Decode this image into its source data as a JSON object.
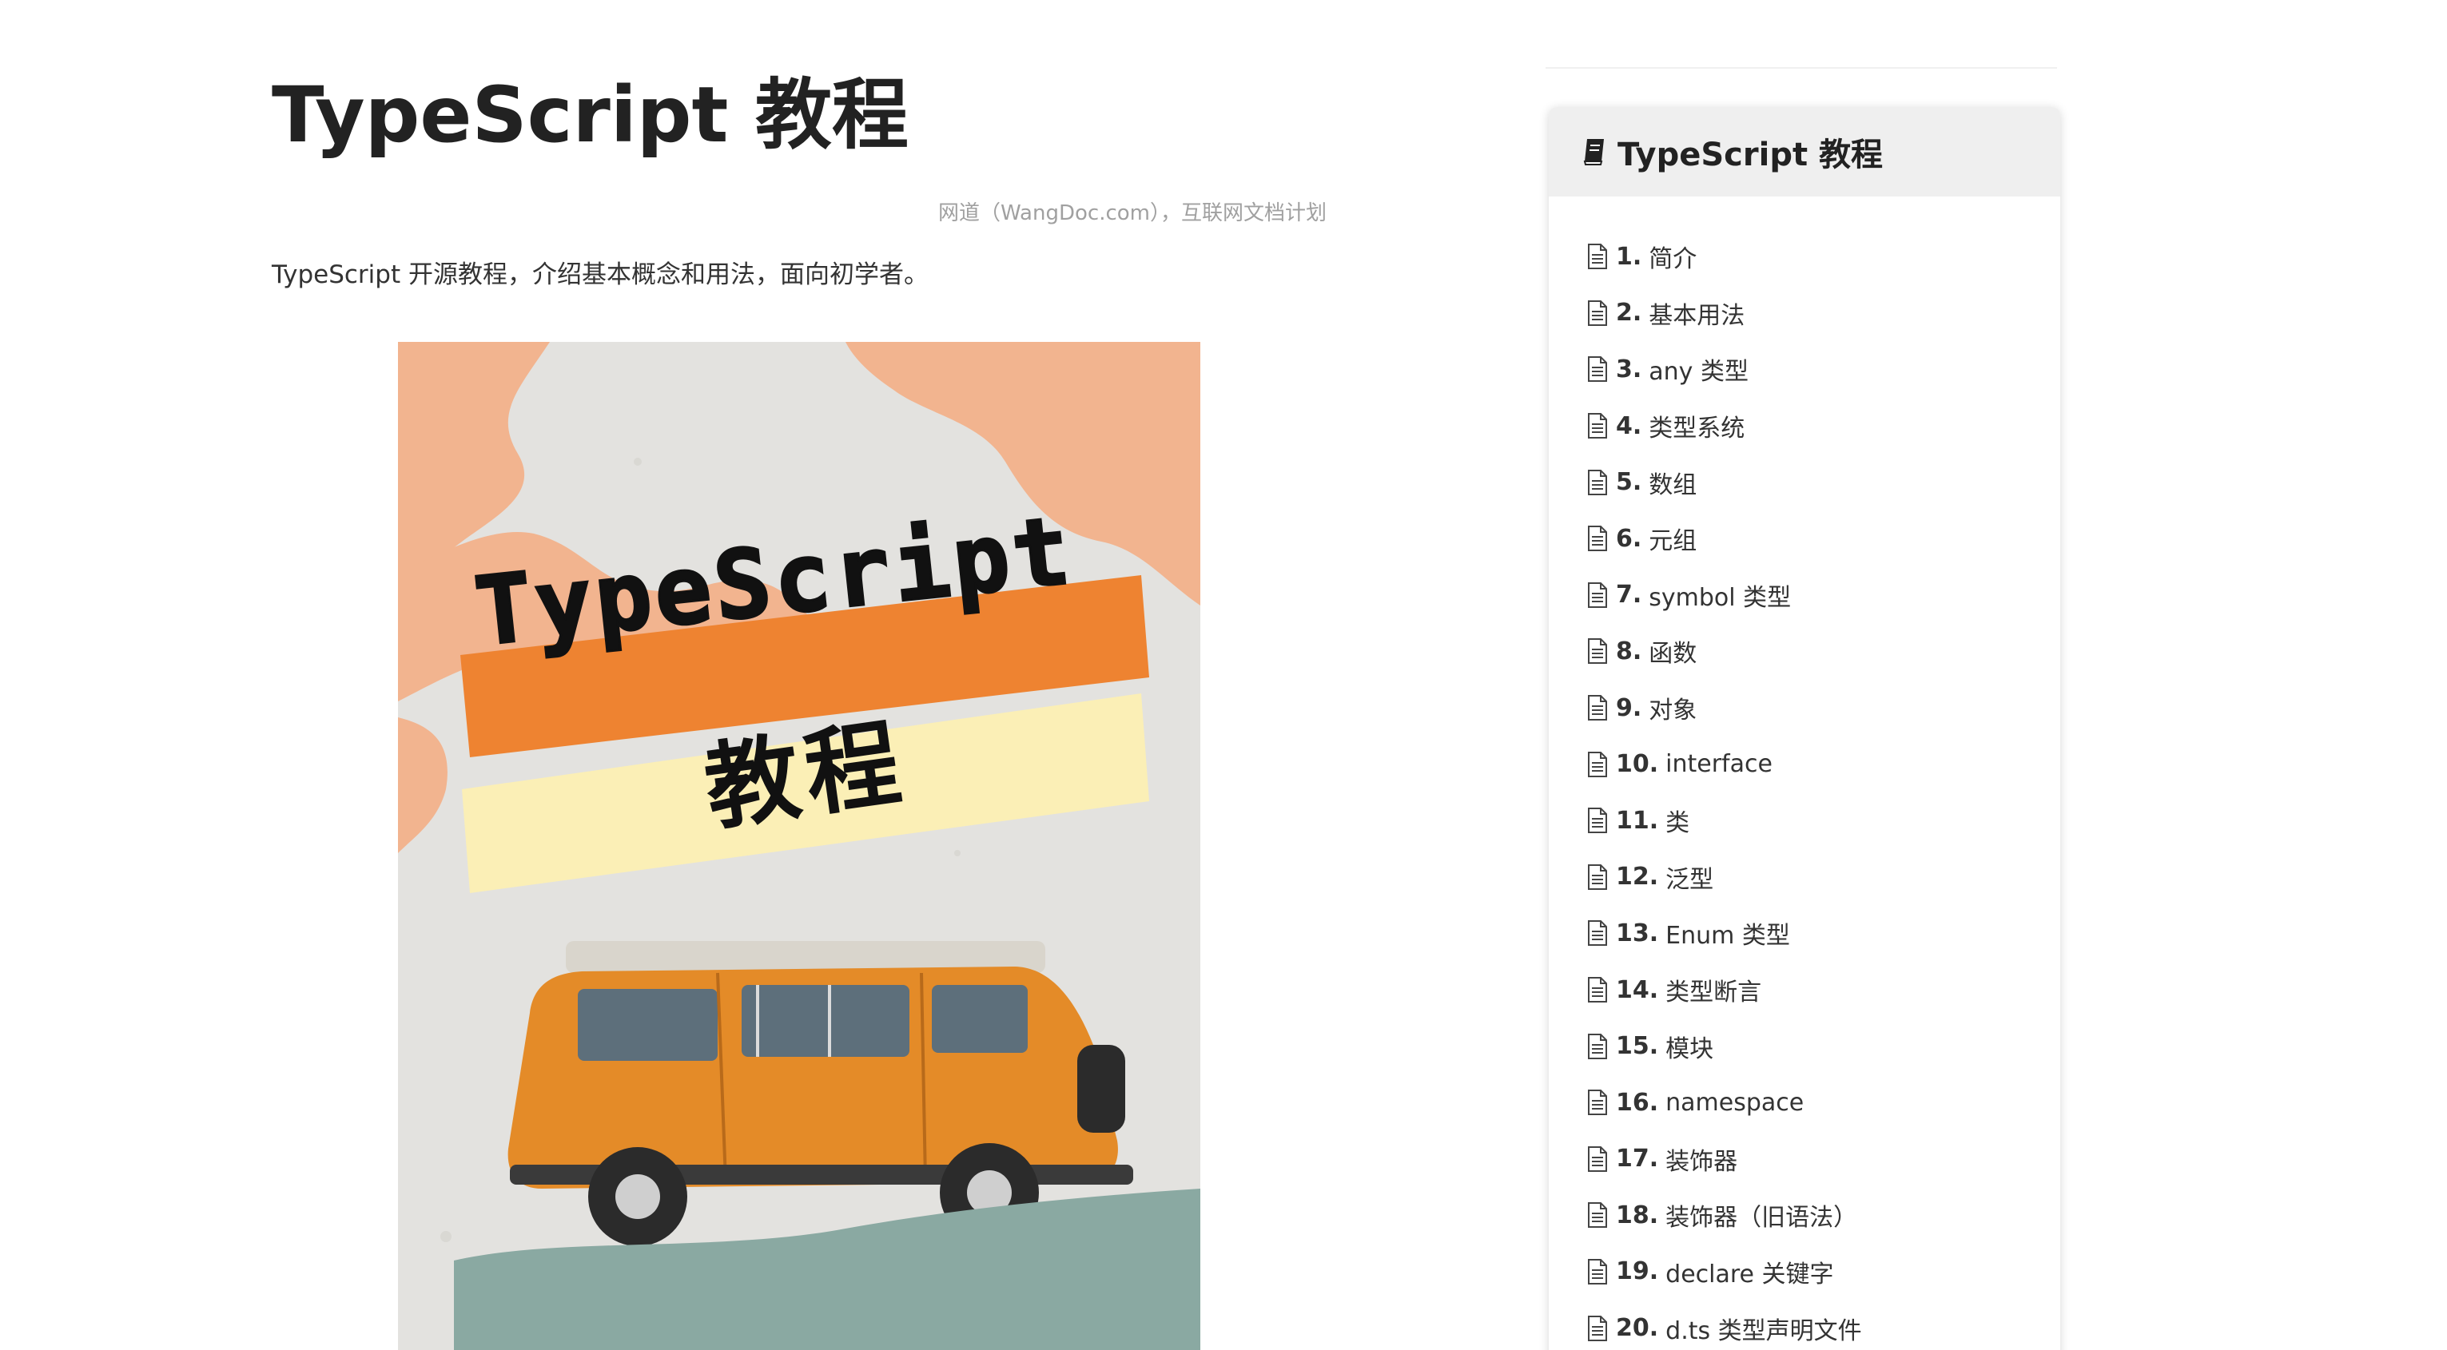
{
  "page": {
    "title": "TypeScript 教程",
    "meta": "网道（WangDoc.com），互联网文档计划",
    "intro": "TypeScript 开源教程，介绍基本概念和用法，面向初学者。"
  },
  "cover": {
    "title_en": "TypeScript",
    "title_zh": "教程",
    "colors": {
      "paper": "#e3e2df",
      "peach": "#f2b48f",
      "orange_band": "#ee8331",
      "yellow_band": "#fbefb6",
      "van": "#e48b28",
      "teal": "#8aa9a2"
    }
  },
  "sidebar": {
    "title": "TypeScript 教程",
    "title_icon": "book-icon",
    "item_icon": "document-icon",
    "items": [
      {
        "num": "1.",
        "label": "简介"
      },
      {
        "num": "2.",
        "label": "基本用法"
      },
      {
        "num": "3.",
        "label": "any 类型"
      },
      {
        "num": "4.",
        "label": "类型系统"
      },
      {
        "num": "5.",
        "label": "数组"
      },
      {
        "num": "6.",
        "label": "元组"
      },
      {
        "num": "7.",
        "label": "symbol 类型"
      },
      {
        "num": "8.",
        "label": "函数"
      },
      {
        "num": "9.",
        "label": "对象"
      },
      {
        "num": "10.",
        "label": "interface"
      },
      {
        "num": "11.",
        "label": "类"
      },
      {
        "num": "12.",
        "label": "泛型"
      },
      {
        "num": "13.",
        "label": "Enum 类型"
      },
      {
        "num": "14.",
        "label": "类型断言"
      },
      {
        "num": "15.",
        "label": "模块"
      },
      {
        "num": "16.",
        "label": "namespace"
      },
      {
        "num": "17.",
        "label": "装饰器"
      },
      {
        "num": "18.",
        "label": "装饰器（旧语法）"
      },
      {
        "num": "19.",
        "label": "declare 关键字"
      },
      {
        "num": "20.",
        "label": "d.ts 类型声明文件"
      }
    ]
  }
}
